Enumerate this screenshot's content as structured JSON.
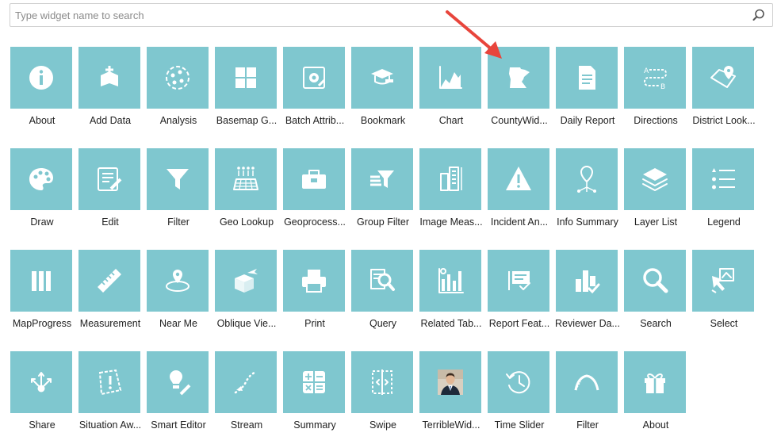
{
  "search": {
    "placeholder": "Type widget name to search"
  },
  "colors": {
    "tile": "#7fc7cf",
    "icon": "#ffffff",
    "arrow": "#e8453c"
  },
  "widgets": [
    {
      "label": "About",
      "icon": "info-icon"
    },
    {
      "label": "Add Data",
      "icon": "add-data-icon"
    },
    {
      "label": "Analysis",
      "icon": "analysis-icon"
    },
    {
      "label": "Basemap G...",
      "icon": "basemap-gallery-icon"
    },
    {
      "label": "Batch Attrib...",
      "icon": "batch-attribute-icon"
    },
    {
      "label": "Bookmark",
      "icon": "bookmark-icon"
    },
    {
      "label": "Chart",
      "icon": "chart-icon"
    },
    {
      "label": "CountyWid...",
      "icon": "minnesota-map-icon"
    },
    {
      "label": "Daily Report",
      "icon": "daily-report-icon"
    },
    {
      "label": "Directions",
      "icon": "directions-icon"
    },
    {
      "label": "District Look...",
      "icon": "district-lookup-icon"
    },
    {
      "label": "Draw",
      "icon": "draw-palette-icon"
    },
    {
      "label": "Edit",
      "icon": "edit-icon"
    },
    {
      "label": "Filter",
      "icon": "filter-funnel-icon"
    },
    {
      "label": "Geo Lookup",
      "icon": "geo-lookup-icon"
    },
    {
      "label": "Geoprocess...",
      "icon": "geoprocessing-toolbox-icon"
    },
    {
      "label": "Group Filter",
      "icon": "group-filter-icon"
    },
    {
      "label": "Image Meas...",
      "icon": "image-measurement-icon"
    },
    {
      "label": "Incident An...",
      "icon": "incident-warning-icon"
    },
    {
      "label": "Info Summary",
      "icon": "info-summary-icon"
    },
    {
      "label": "Layer List",
      "icon": "layer-list-icon"
    },
    {
      "label": "Legend",
      "icon": "legend-icon"
    },
    {
      "label": "MapProgress",
      "icon": "map-progress-icon"
    },
    {
      "label": "Measurement",
      "icon": "ruler-icon"
    },
    {
      "label": "Near Me",
      "icon": "near-me-icon"
    },
    {
      "label": "Oblique Vie...",
      "icon": "oblique-viewer-icon"
    },
    {
      "label": "Print",
      "icon": "printer-icon"
    },
    {
      "label": "Query",
      "icon": "query-icon"
    },
    {
      "label": "Related Tab...",
      "icon": "related-table-icon"
    },
    {
      "label": "Report Feat...",
      "icon": "report-feature-icon"
    },
    {
      "label": "Reviewer Da...",
      "icon": "reviewer-dashboard-icon"
    },
    {
      "label": "Search",
      "icon": "search-icon"
    },
    {
      "label": "Select",
      "icon": "select-icon"
    },
    {
      "label": "Share",
      "icon": "share-icon"
    },
    {
      "label": "Situation Aw...",
      "icon": "situation-awareness-icon"
    },
    {
      "label": "Smart Editor",
      "icon": "smart-editor-icon"
    },
    {
      "label": "Stream",
      "icon": "stream-icon"
    },
    {
      "label": "Summary",
      "icon": "calculator-icon"
    },
    {
      "label": "Swipe",
      "icon": "swipe-icon"
    },
    {
      "label": "TerribleWid...",
      "icon": "person-photo-icon"
    },
    {
      "label": "Time Slider",
      "icon": "time-slider-icon"
    },
    {
      "label": "Filter",
      "icon": "filter-arc-icon"
    },
    {
      "label": "About",
      "icon": "gift-icon"
    }
  ]
}
